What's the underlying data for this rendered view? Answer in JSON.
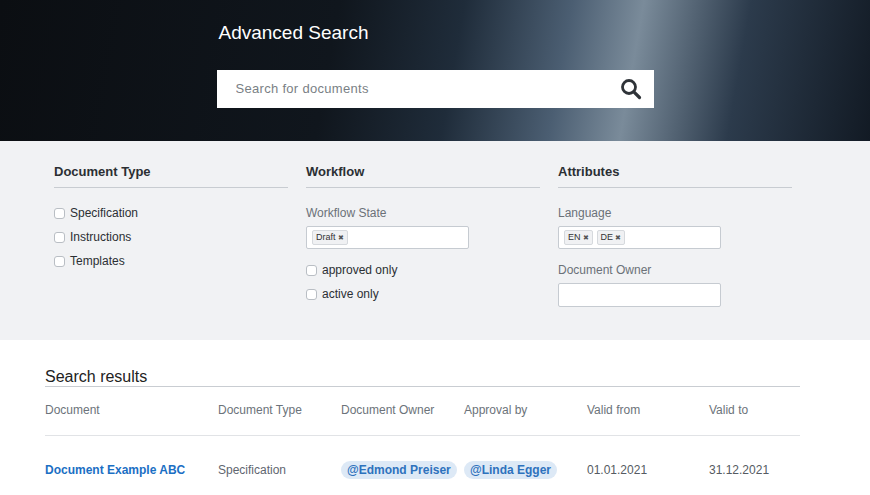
{
  "header": {
    "title": "Advanced Search",
    "search": {
      "placeholder": "Search for documents"
    }
  },
  "filters": {
    "document_type": {
      "heading": "Document Type",
      "options": [
        {
          "label": "Specification",
          "checked": false
        },
        {
          "label": "Instructions",
          "checked": false
        },
        {
          "label": "Templates",
          "checked": false
        }
      ]
    },
    "workflow": {
      "heading": "Workflow",
      "state_label": "Workflow State",
      "state_tags": [
        {
          "label": "Draft",
          "remove": "✖"
        }
      ],
      "options": [
        {
          "label": "approved only",
          "checked": false
        },
        {
          "label": "active only",
          "checked": false
        }
      ]
    },
    "attributes": {
      "heading": "Attributes",
      "language_label": "Language",
      "language_tags": [
        {
          "label": "EN",
          "remove": "✖"
        },
        {
          "label": "DE",
          "remove": "✖"
        }
      ],
      "owner_label": "Document Owner",
      "owner_value": ""
    }
  },
  "results": {
    "title": "Search results",
    "columns": [
      "Document",
      "Document Type",
      "Document Owner",
      "Approval by",
      "Valid from",
      "Valid to"
    ],
    "rows": [
      {
        "cells": [
          {
            "text": "Document Example ABC",
            "kind": "link"
          },
          {
            "text": "Specification",
            "kind": "text"
          },
          {
            "text": "@Edmond Preiser",
            "kind": "user"
          },
          {
            "text": "@Linda Egger",
            "kind": "user"
          },
          {
            "text": "01.01.2021",
            "kind": "date"
          },
          {
            "text": "31.12.2021",
            "kind": "date"
          }
        ]
      }
    ]
  }
}
